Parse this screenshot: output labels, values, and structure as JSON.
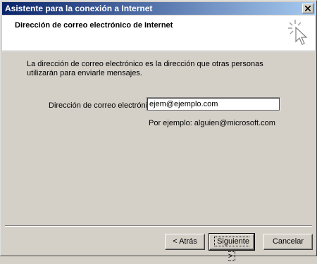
{
  "window": {
    "title": "Asistente para la conexión a Internet",
    "close_glyph": "✕"
  },
  "header": {
    "title": "Dirección de correo electrónico de Internet",
    "icon": "sparkle-cursor-icon"
  },
  "content": {
    "description": "La dirección de correo electrónico es la dirección que otras personas utilizarán para enviarle mensajes.",
    "email_label": "Dirección de correo electrónico:",
    "email_value": "ejem@ejemplo.com",
    "example_text": "Por ejemplo: alguien@microsoft.com"
  },
  "buttons": {
    "back": "< Atrás",
    "next": "Siguiente >",
    "cancel": "Cancelar"
  },
  "colors": {
    "titlebar_start": "#0a246a",
    "titlebar_end": "#a6caf0",
    "dialog_bg": "#d4d0c8"
  }
}
